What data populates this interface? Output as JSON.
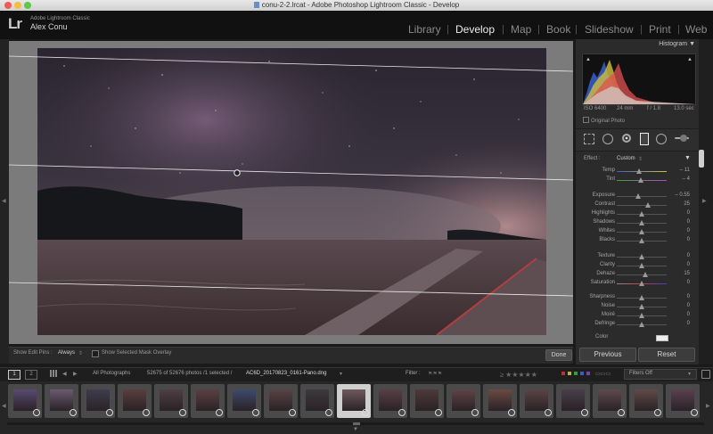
{
  "window": {
    "title": "conu-2-2.lrcat - Adobe Photoshop Lightroom Classic - Develop"
  },
  "identity": {
    "logo": "Lr",
    "app_name": "Adobe Lightroom Classic",
    "user": "Alex Conu"
  },
  "modules": [
    {
      "label": "Library",
      "active": false
    },
    {
      "label": "Develop",
      "active": true
    },
    {
      "label": "Map",
      "active": false
    },
    {
      "label": "Book",
      "active": false
    },
    {
      "label": "Slideshow",
      "active": false
    },
    {
      "label": "Print",
      "active": false
    },
    {
      "label": "Web",
      "active": false
    }
  ],
  "toolbar": {
    "edit_pins_label": "Show Edit Pins :",
    "edit_pins_value": "Always",
    "mask_overlay_label": "Show Selected Mask Overlay",
    "done_label": "Done"
  },
  "histogram": {
    "title": "Histogram",
    "iso": "ISO 6400",
    "focal": "24 mm",
    "aperture": "f / 1.8",
    "shutter": "13.0 sec",
    "original_photo": "Original Photo"
  },
  "effect": {
    "label": "Effect :",
    "value": "Custom"
  },
  "sliders": [
    {
      "label": "Temp",
      "value": "– 11",
      "pos": 0.45,
      "gradient": "temp"
    },
    {
      "label": "Tint",
      "value": "– 4",
      "pos": 0.48,
      "gradient": "tint"
    },
    {
      "label": "Exposure",
      "value": "– 0.55",
      "pos": 0.42
    },
    {
      "label": "Contrast",
      "value": "25",
      "pos": 0.62
    },
    {
      "label": "Highlights",
      "value": "0",
      "pos": 0.5
    },
    {
      "label": "Shadows",
      "value": "0",
      "pos": 0.5
    },
    {
      "label": "Whites",
      "value": "0",
      "pos": 0.5
    },
    {
      "label": "Blacks",
      "value": "0",
      "pos": 0.5
    },
    {
      "label": "Texture",
      "value": "0",
      "pos": 0.5
    },
    {
      "label": "Clarity",
      "value": "0",
      "pos": 0.5
    },
    {
      "label": "Dehaze",
      "value": "15",
      "pos": 0.57
    },
    {
      "label": "Saturation",
      "value": "0",
      "pos": 0.5,
      "gradient": "sat"
    },
    {
      "label": "Sharpness",
      "value": "0",
      "pos": 0.5
    },
    {
      "label": "Noise",
      "value": "0",
      "pos": 0.5
    },
    {
      "label": "Moiré",
      "value": "0",
      "pos": 0.5
    },
    {
      "label": "Defringe",
      "value": "0",
      "pos": 0.5
    }
  ],
  "color_label": "Color",
  "buttons": {
    "previous": "Previous",
    "reset": "Reset"
  },
  "filmstrip_bar": {
    "page1": "1",
    "page2": "2",
    "source": "All Photographs",
    "count": "52675 of 52676 photos /1 selected /",
    "filename": "AC6D_20170823_0161-Pano.dng",
    "filter_label": "Filter :",
    "filters_off": "Filters Off"
  },
  "colors": {
    "accent_active": "#ededed",
    "panel_bg": "#2b2b2b",
    "selected_thumb": "#cfcfcf"
  },
  "thumbnails": [
    {
      "tone": "#5a4a72",
      "selected": false
    },
    {
      "tone": "#6b5a6e",
      "selected": false
    },
    {
      "tone": "#3e3d4e",
      "selected": false
    },
    {
      "tone": "#5a3e3e",
      "selected": false
    },
    {
      "tone": "#4e3f43",
      "selected": false
    },
    {
      "tone": "#5a4042",
      "selected": false
    },
    {
      "tone": "#3e4a6e",
      "selected": false
    },
    {
      "tone": "#574446",
      "selected": false
    },
    {
      "tone": "#3e3a3e",
      "selected": false
    },
    {
      "tone": "#6e5a5e",
      "selected": true
    },
    {
      "tone": "#574046",
      "selected": false
    },
    {
      "tone": "#4e3a3a",
      "selected": false
    },
    {
      "tone": "#5e4446",
      "selected": false
    },
    {
      "tone": "#6a4a42",
      "selected": false
    },
    {
      "tone": "#5a4446",
      "selected": false
    },
    {
      "tone": "#4a3e4a",
      "selected": false
    },
    {
      "tone": "#5e4a4e",
      "selected": false
    },
    {
      "tone": "#604a46",
      "selected": false
    },
    {
      "tone": "#5a4050",
      "selected": false
    }
  ]
}
